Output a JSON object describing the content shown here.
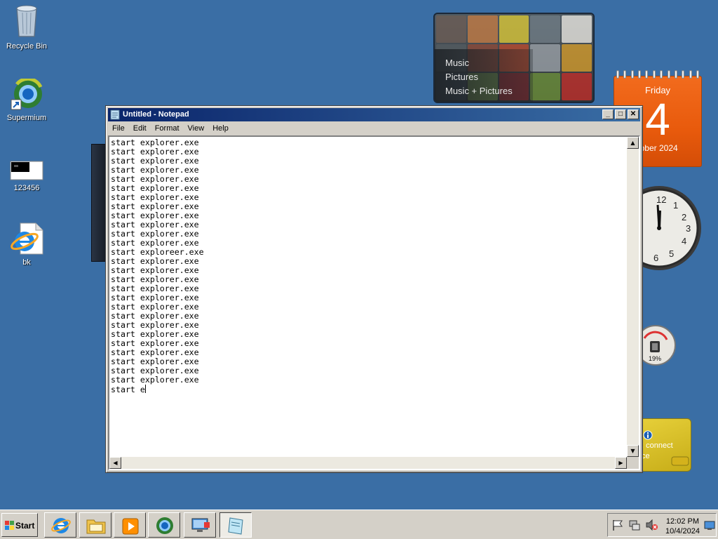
{
  "desktop": {
    "icons": [
      {
        "label": "Recycle Bin",
        "icon": "recycle-bin-icon"
      },
      {
        "label": "Supermium",
        "icon": "supermium-browser-icon"
      },
      {
        "label": "123456",
        "icon": "image-file-icon"
      },
      {
        "label": "bk",
        "icon": "internet-explorer-icon"
      }
    ]
  },
  "gadgets": {
    "media_center": {
      "options": [
        "Music",
        "Pictures",
        "Music + Pictures"
      ]
    },
    "calendar": {
      "day_of_week": "Friday",
      "day": "4",
      "month_year": "tober 2024"
    },
    "clock": {
      "numbers": [
        "12",
        "1",
        "2",
        "3",
        "4",
        "5",
        "6"
      ]
    },
    "cpu_meter": {
      "value": "19%"
    },
    "weather": {
      "line1": ": connect",
      "line2": "ce"
    }
  },
  "notepad": {
    "title": "Untitled - Notepad",
    "menu": [
      "File",
      "Edit",
      "Format",
      "View",
      "Help"
    ],
    "lines": [
      "start explorer.exe",
      "start explorer.exe",
      "start explorer.exe",
      "start explorer.exe",
      "start explorer.exe",
      "start explorer.exe",
      "start explorer.exe",
      "start explorer.exe",
      "start explorer.exe",
      "start explorer.exe",
      "start explorer.exe",
      "start explorer.exe",
      "start exploreer.exe",
      "start explorer.exe",
      "start explorer.exe",
      "start explorer.exe",
      "start explorer.exe",
      "start explorer.exe",
      "start explorer.exe",
      "start explorer.exe",
      "start explorer.exe",
      "start explorer.exe",
      "start explorer.exe",
      "start explorer.exe",
      "start explorer.exe",
      "start explorer.exe",
      "start explorer.exe",
      "start e"
    ],
    "controls": {
      "minimize": "_",
      "maximize": "□",
      "close": "✕"
    }
  },
  "taskbar": {
    "start_label": "Start",
    "quick_launch": [
      "internet-explorer-icon",
      "file-explorer-icon",
      "media-player-icon",
      "supermium-browser-icon",
      "network-computer-icon",
      "notepad-icon"
    ],
    "clock_time": "12:02 PM",
    "clock_date": "10/4/2024",
    "tray_icons": [
      "action-center-flag-icon",
      "network-icon",
      "volume-muted-icon",
      "show-desktop-icon"
    ]
  }
}
